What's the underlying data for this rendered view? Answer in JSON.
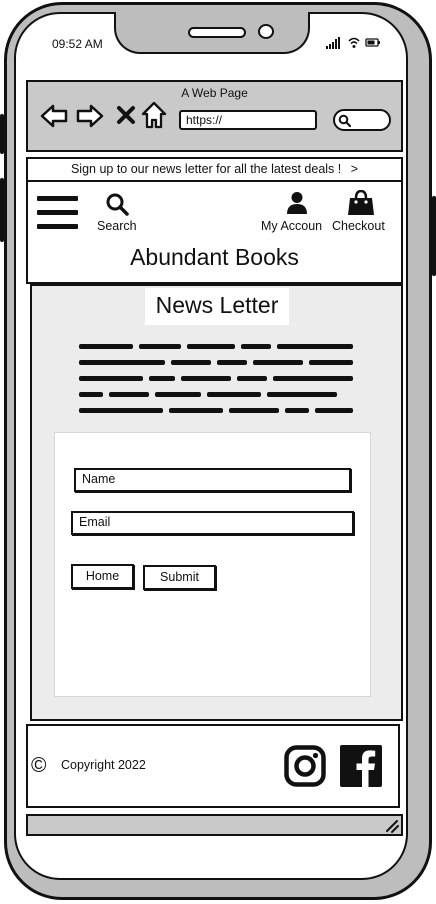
{
  "status_bar": {
    "time": "09:52 AM"
  },
  "browser": {
    "page_title": "A Web Page",
    "url": "https://",
    "icons": [
      "back-arrow-icon",
      "forward-arrow-icon",
      "close-icon",
      "home-icon",
      "search-icon"
    ]
  },
  "banner": {
    "text": "Sign up to our news letter for all the latest deals !",
    "arrow": ">"
  },
  "header": {
    "menu_icon": "hamburger-menu-icon",
    "search_label": "Search",
    "account_label": "My Accoun",
    "checkout_label": "Checkout",
    "store_name": "Abundant Books"
  },
  "newsletter": {
    "title": "News Letter",
    "name_placeholder": "Name",
    "email_placeholder": "Email",
    "home_button": "Home",
    "submit_button": "Submit"
  },
  "footer": {
    "copyright_symbol": "©",
    "copyright_text": "Copyright 2022",
    "social_icons": [
      "instagram-icon",
      "facebook-icon"
    ]
  },
  "colors": {
    "frame_gray": "#bdbdbd",
    "bar_gray": "#c9c9c9",
    "content_gray": "#ececec",
    "ink": "#111111"
  }
}
